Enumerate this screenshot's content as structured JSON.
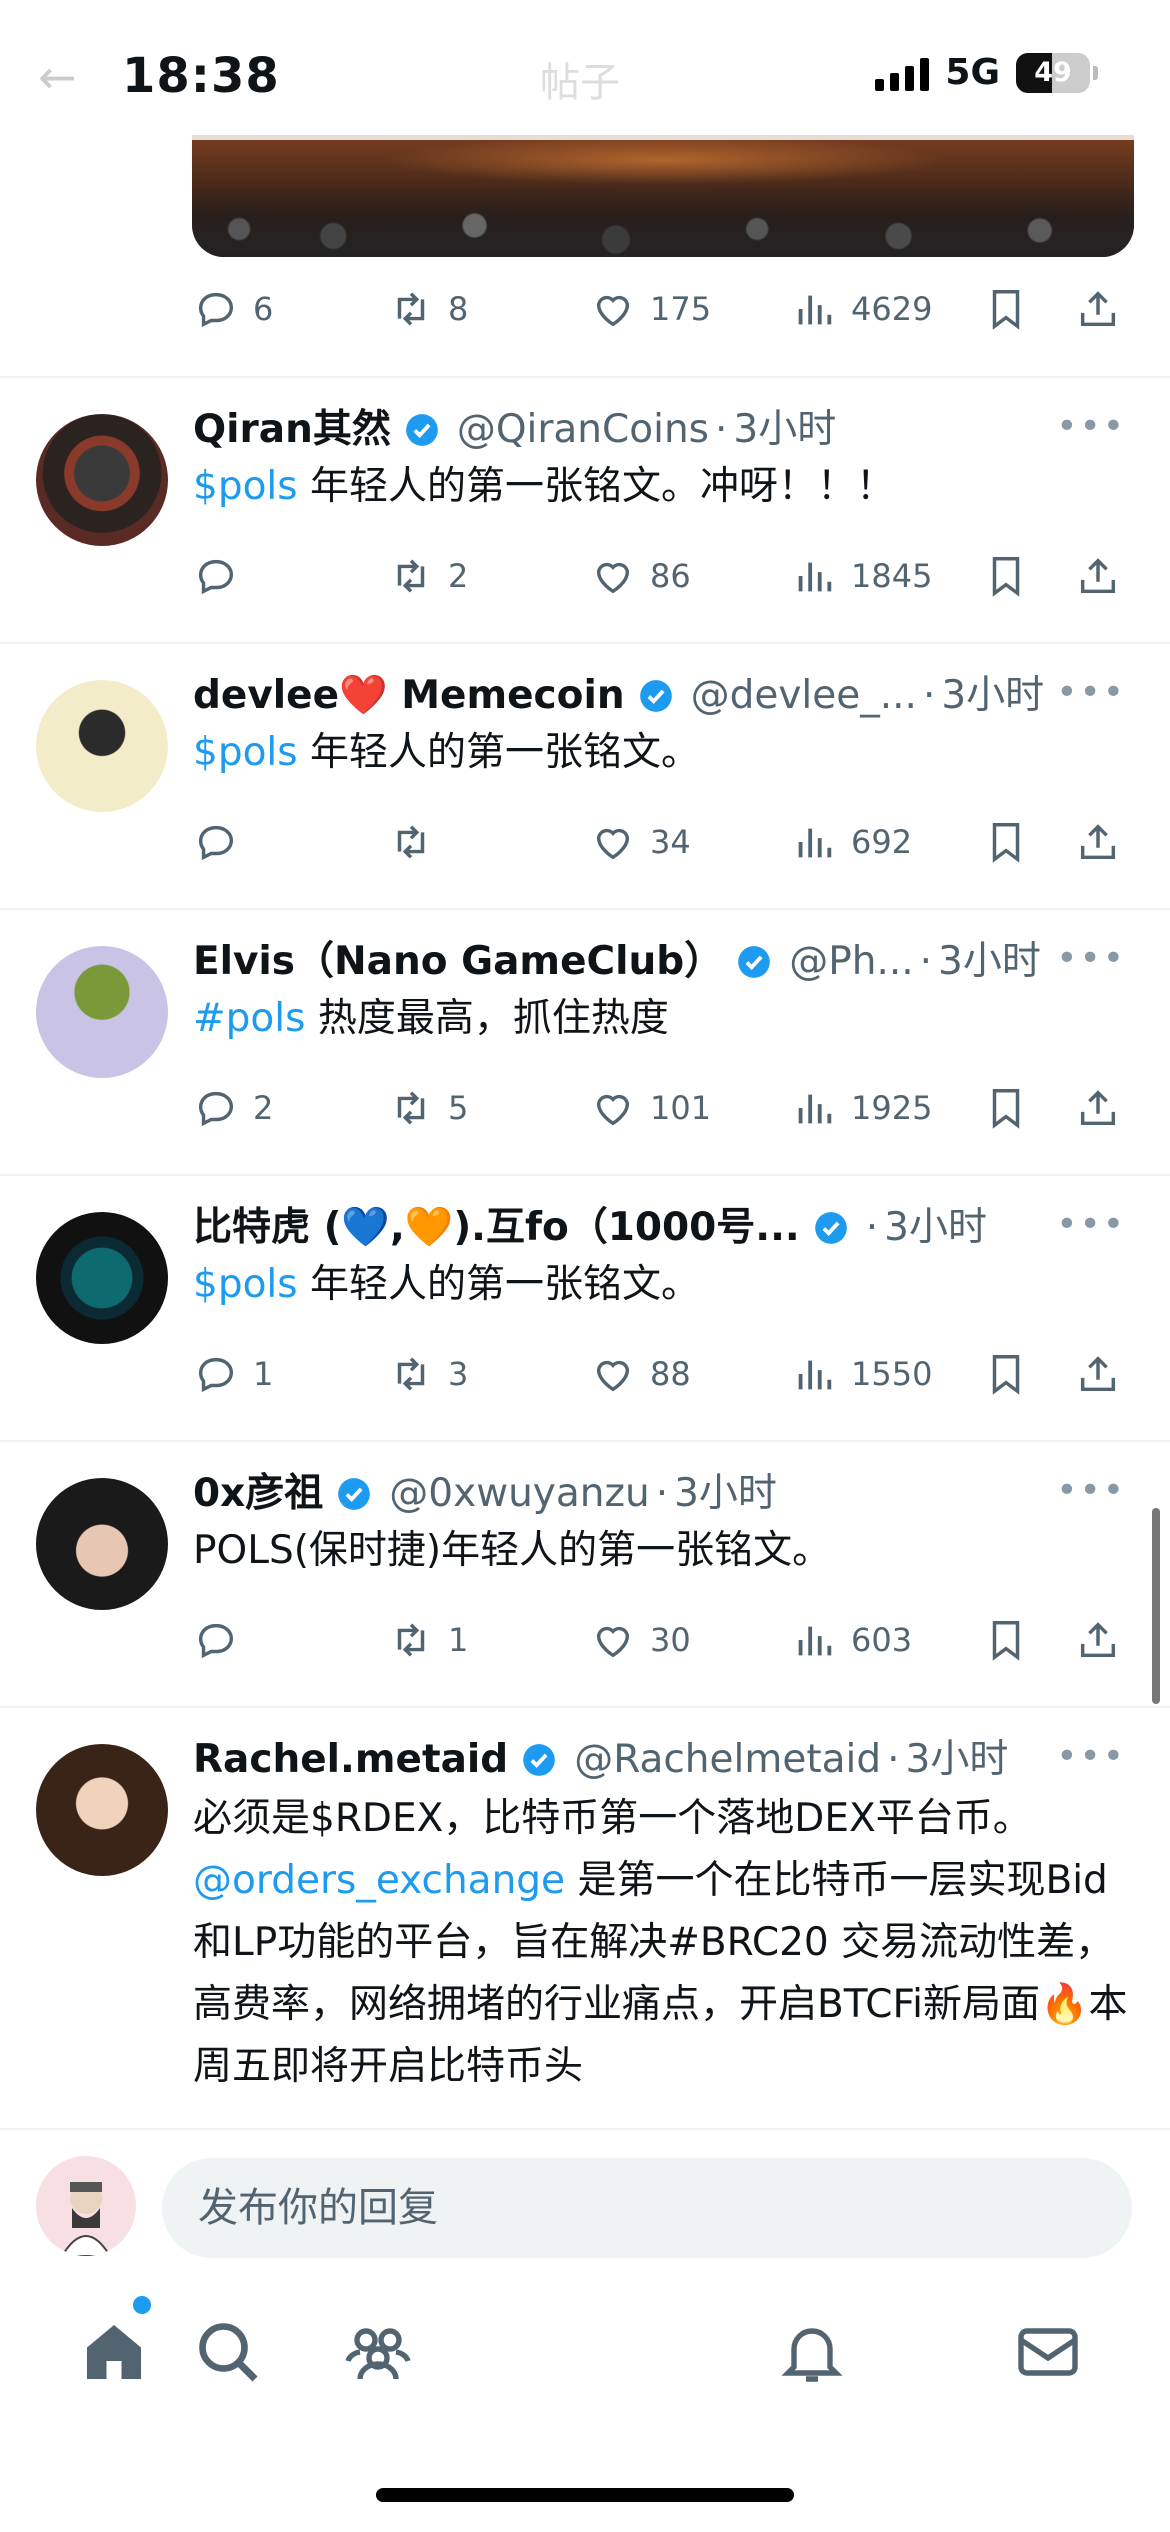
{
  "status_bar": {
    "time": "18:38",
    "network": "5G",
    "battery": "49"
  },
  "nav": {
    "ghost_title": "帖子"
  },
  "top_tweet_actions": {
    "replies": "6",
    "retweets": "8",
    "likes": "175",
    "views": "4629"
  },
  "tweets": [
    {
      "name": "Qiran其然",
      "handle": "@QiranCoins",
      "time": "3小时",
      "tag": "$pols",
      "text": " 年轻人的第一张铭文。冲呀！！！",
      "replies": "",
      "retweets": "2",
      "likes": "86",
      "views": "1845"
    },
    {
      "name": "devlee❤️ Memecoin",
      "handle": "@devlee_...",
      "time": "3小时",
      "tag": "$pols",
      "text": " 年轻人的第一张铭文。",
      "replies": "",
      "retweets": "",
      "likes": "34",
      "views": "692"
    },
    {
      "name": "Elvis（Nano GameClub）",
      "handle": "@Ph...",
      "time": "3小时",
      "tag": "#pols",
      "text": " 热度最高，抓住热度",
      "replies": "2",
      "retweets": "5",
      "likes": "101",
      "views": "1925"
    },
    {
      "name": "比特虎 (💙,🧡).互fo（1000号...",
      "handle": "",
      "time": "3小时",
      "tag": "$pols",
      "text": " 年轻人的第一张铭文。",
      "replies": "1",
      "retweets": "3",
      "likes": "88",
      "views": "1550"
    },
    {
      "name": "0x彦祖",
      "handle": "@0xwuyanzu",
      "time": "3小时",
      "tag": "",
      "text": "POLS(保时捷)年轻人的第一张铭文。",
      "replies": "",
      "retweets": "1",
      "likes": "30",
      "views": "603"
    },
    {
      "name": "Rachel.metaid",
      "handle": "@Rachelmetaid",
      "time": "3小时",
      "text_part1": "必须是$RDEX，比特币第一个落地DEX平台币。",
      "mention": "@orders_exchange",
      "text_part2": " 是第一个在比特币一层实现Bid和LP功能的平台，旨在解决#BRC20 交易流动性差，高费率，网络拥堵的行业痛点，开启BTCFi新局面🔥本周五即将开启比特币头"
    }
  ],
  "reply_box": {
    "placeholder": "发布你的回复"
  },
  "icons": [
    "reply-icon",
    "retweet-icon",
    "like-icon",
    "views-icon",
    "bookmark-icon",
    "share-icon",
    "verified-icon",
    "home-icon",
    "search-icon",
    "communities-icon",
    "notifications-icon",
    "messages-icon"
  ],
  "colors": {
    "accent": "#1d9bf0",
    "secondary_text": "#536471",
    "divider": "#eff3f4"
  }
}
